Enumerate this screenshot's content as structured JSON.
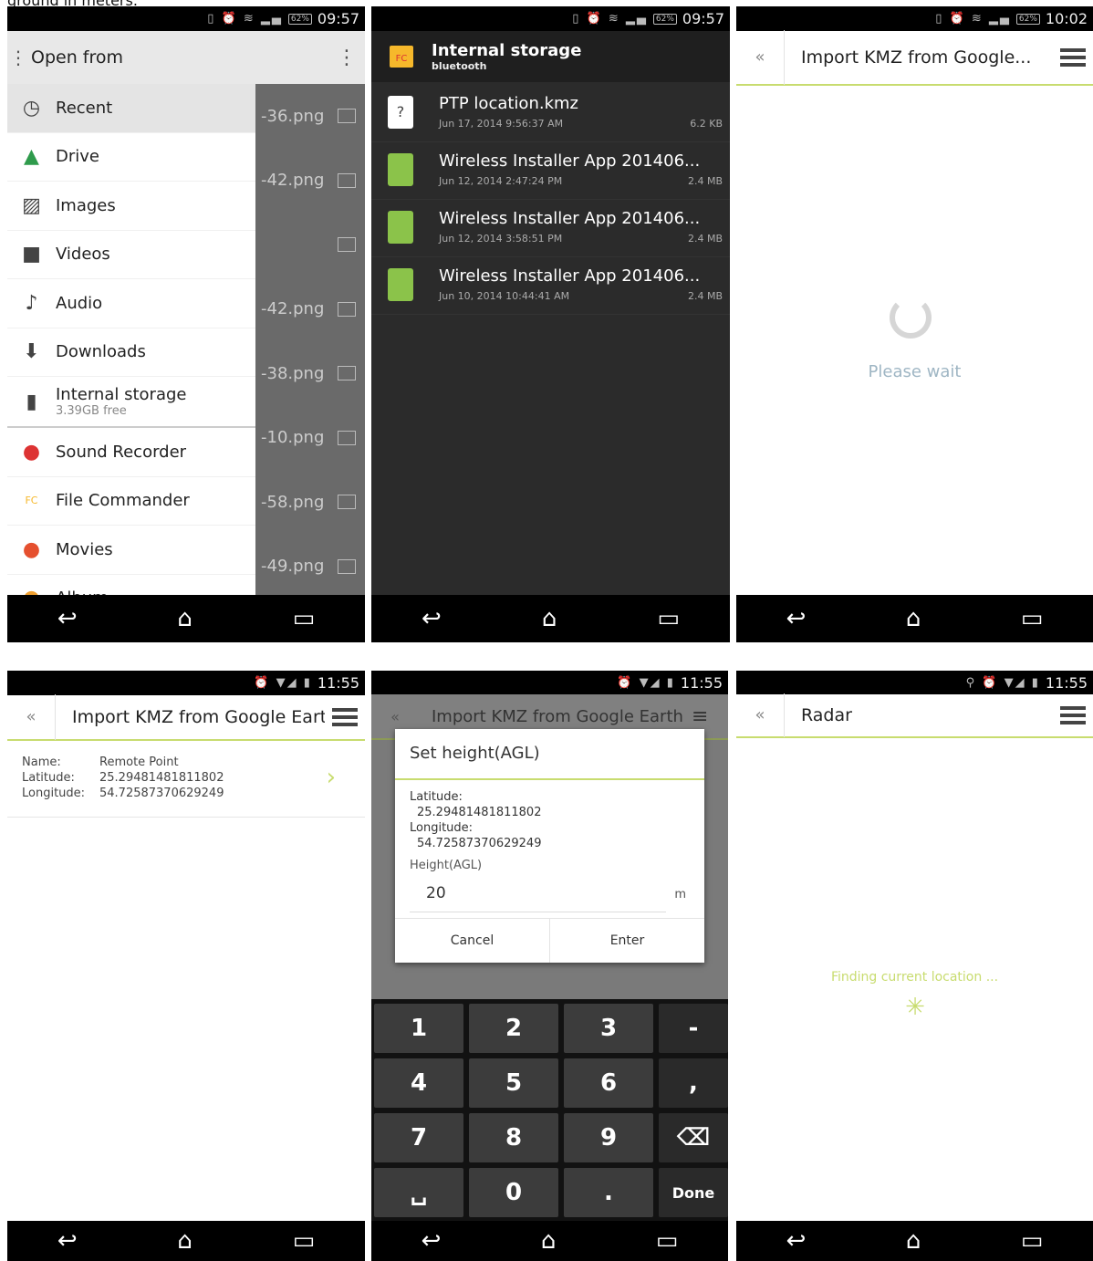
{
  "caption": "ground in meters.",
  "screen1": {
    "time": "09:57",
    "battery": "62%",
    "title": "Open from",
    "bg_files": [
      "-36.png",
      "-42.png",
      "",
      "-42.png",
      "-38.png",
      "-10.png",
      "-58.png",
      "-49.png"
    ],
    "drawer": [
      {
        "label": "Recent",
        "icon": "clock-icon"
      },
      {
        "label": "Drive",
        "icon": "drive-icon"
      },
      {
        "label": "Images",
        "icon": "image-icon"
      },
      {
        "label": "Videos",
        "icon": "video-icon"
      },
      {
        "label": "Audio",
        "icon": "audio-icon"
      },
      {
        "label": "Downloads",
        "icon": "download-icon"
      },
      {
        "label": "Internal storage",
        "sub": "3.39GB free",
        "icon": "sdcard-icon"
      },
      {
        "label": "Sound Recorder",
        "icon": "microphone-icon"
      },
      {
        "label": "File Commander",
        "icon": "file-commander-icon"
      },
      {
        "label": "Movies",
        "icon": "movies-icon"
      },
      {
        "label": "Album",
        "icon": "album-icon"
      }
    ]
  },
  "screen2": {
    "time": "09:57",
    "battery": "62%",
    "title": "Internal storage",
    "subtitle": "bluetooth",
    "files": [
      {
        "name": "PTP location.kmz",
        "date": "Jun 17, 2014 9:56:37 AM",
        "size": "6.2 KB",
        "type": "unknown"
      },
      {
        "name": "Wireless Installer App 201406...",
        "date": "Jun 12, 2014 2:47:24 PM",
        "size": "2.4 MB",
        "type": "apk"
      },
      {
        "name": "Wireless Installer App 201406...",
        "date": "Jun 12, 2014 3:58:51 PM",
        "size": "2.4 MB",
        "type": "apk"
      },
      {
        "name": "Wireless Installer App 201406...",
        "date": "Jun 10, 2014 10:44:41 AM",
        "size": "2.4 MB",
        "type": "apk"
      }
    ]
  },
  "screen3": {
    "time": "10:02",
    "battery": "62%",
    "title": "Import KMZ from Google...",
    "wait": "Please wait"
  },
  "screen4": {
    "time": "11:55",
    "title": "Import KMZ from Google Earth",
    "fields": [
      {
        "k": "Name:",
        "v": "Remote Point"
      },
      {
        "k": "Latitude:",
        "v": "25.29481481811802"
      },
      {
        "k": "Longitude:",
        "v": "54.72587370629249"
      }
    ]
  },
  "screen5": {
    "time": "11:55",
    "title": "Import KMZ from Google Earth",
    "dialog": {
      "title": "Set height(AGL)",
      "lat_label": "Latitude:",
      "lat": "25.29481481811802",
      "lon_label": "Longitude:",
      "lon": "54.72587370629249",
      "height_label": "Height(AGL)",
      "height_value": "20",
      "unit": "m",
      "cancel": "Cancel",
      "enter": "Enter"
    },
    "keys": [
      "1",
      "2",
      "3",
      "-",
      "4",
      "5",
      "6",
      ",",
      "7",
      "8",
      "9",
      "⌫",
      "␣",
      "0",
      ".",
      "Done"
    ]
  },
  "screen6": {
    "time": "11:55",
    "title": "Radar",
    "status": "Finding current location ..."
  },
  "colors": {
    "accent": "#c8dc6f",
    "dark": "#2b2b2b",
    "wait": "#9fb6c4"
  }
}
